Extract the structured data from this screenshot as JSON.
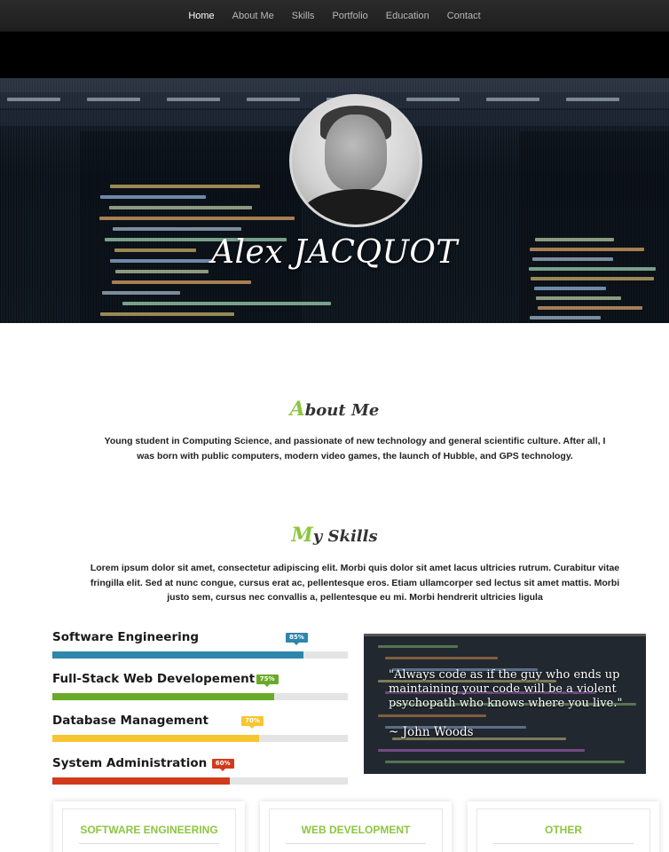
{
  "nav": {
    "items": [
      {
        "label": "Home",
        "active": true
      },
      {
        "label": "About Me",
        "active": false
      },
      {
        "label": "Skills",
        "active": false
      },
      {
        "label": "Portfolio",
        "active": false
      },
      {
        "label": "Education",
        "active": false
      },
      {
        "label": "Contact",
        "active": false
      }
    ]
  },
  "hero": {
    "name": "Alex JACQUOT",
    "avatar_icon": "portrait-photo",
    "background": "ide-code-screenshot"
  },
  "about": {
    "title_first": "A",
    "title_rest": "bout Me",
    "text": "Young student in Computing Science, and passionate of new technology and general scientific culture. After all, I was born with public computers, modern video games, the launch of Hubble, and GPS technology."
  },
  "skills": {
    "title_first": "M",
    "title_rest": "y Skills",
    "text": "Lorem ipsum dolor sit amet, consectetur adipiscing elit. Morbi quis dolor sit amet lacus ultricies rutrum. Curabitur vitae fringilla elit. Sed at nunc congue, cursus erat ac, pellentesque eros. Etiam ullamcorper sed lectus sit amet mattis. Morbi justo sem, cursus nec convallis a, pellentesque eu mi. Morbi hendrerit ultricies ligula",
    "bars": [
      {
        "name": "Software Engineering",
        "percent": 85,
        "label": "85%",
        "color": "#2e86ab"
      },
      {
        "name": "Full-Stack Web Developement",
        "percent": 75,
        "label": "75%",
        "color": "#6aaa2a"
      },
      {
        "name": "Database Management",
        "percent": 70,
        "label": "70%",
        "color": "#f7c531"
      },
      {
        "name": "System Administration",
        "percent": 60,
        "label": "60%",
        "color": "#d23a1c"
      }
    ]
  },
  "quote": {
    "text": "\"Always code as if the guy who ends up maintaining your code will be a violent psychopath who knows where you live.\"",
    "author": "~ John Woods"
  },
  "cards": [
    {
      "title": "SOFTWARE ENGINEERING"
    },
    {
      "title": "WEB DEVELOPMENT"
    },
    {
      "title": "OTHER"
    }
  ],
  "colors": {
    "accent": "#8cc63f",
    "nav_bg": "#262626"
  }
}
